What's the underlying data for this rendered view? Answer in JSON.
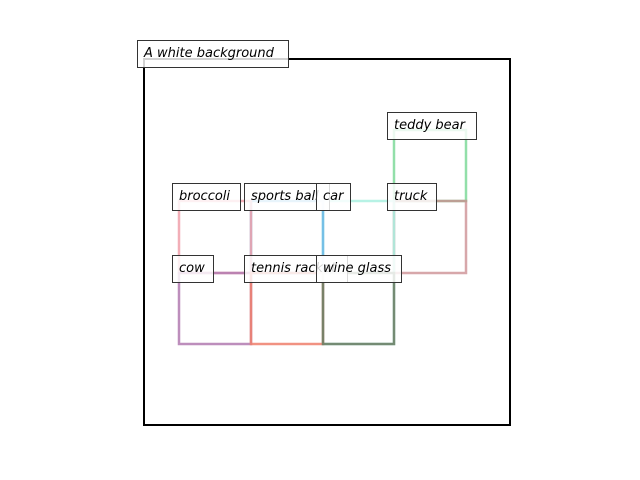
{
  "caption": "A white background",
  "objects": [
    {
      "id": "teddy-bear",
      "label": "teddy bear",
      "color": "#7fd99a"
    },
    {
      "id": "broccoli",
      "label": "broccoli",
      "color": "#f0a0aa"
    },
    {
      "id": "sports-ball",
      "label": "sports ball",
      "color": "#6ab7e6"
    },
    {
      "id": "car",
      "label": "car",
      "color": "#aaf0e0"
    },
    {
      "id": "truck",
      "label": "truck",
      "color": "#c98a8e"
    },
    {
      "id": "cow",
      "label": "cow",
      "color": "#b27ab0"
    },
    {
      "id": "tennis-racket",
      "label": "tennis racket",
      "color": "#ee7f6c"
    },
    {
      "id": "wine-glass",
      "label": "wine glass",
      "color": "#6d7f66"
    }
  ]
}
